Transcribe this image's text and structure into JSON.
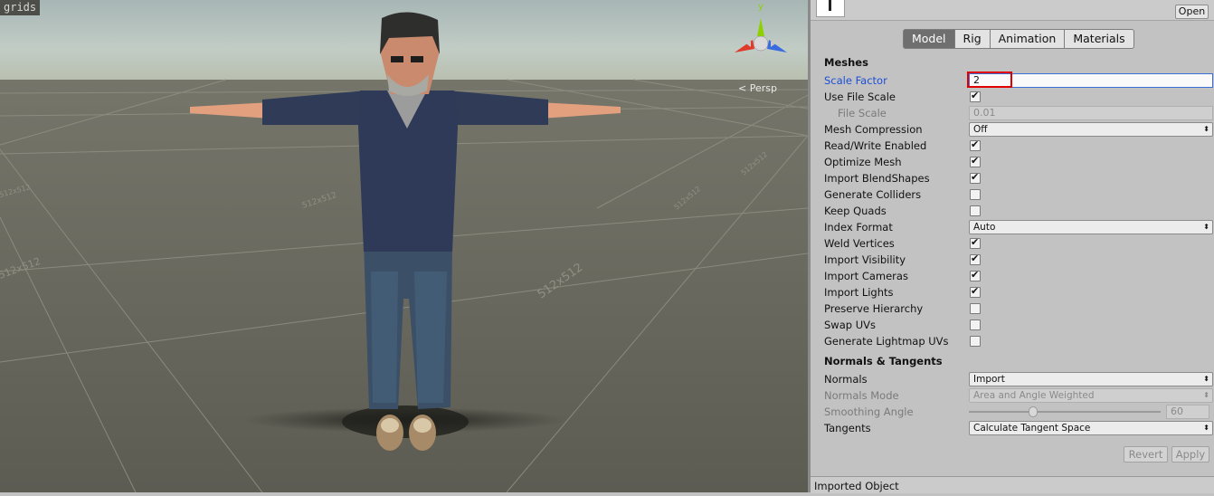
{
  "scene": {
    "grid_label": "grids",
    "projection": "Persp",
    "gizmo_axis": "y",
    "grid_texts": [
      "512x512",
      "512x512",
      "512x512",
      "512x512",
      "512x512",
      "512x512"
    ],
    "ground_color": "#64645a",
    "sky_color": "#b9c6c0"
  },
  "topbar": {
    "thumb_icon": "asset-preview-icon",
    "open_label": "Open"
  },
  "tabs": [
    {
      "label": "Model",
      "active": true
    },
    {
      "label": "Rig",
      "active": false
    },
    {
      "label": "Animation",
      "active": false
    },
    {
      "label": "Materials",
      "active": false
    }
  ],
  "meshes": {
    "header": "Meshes",
    "scale_factor": {
      "label": "Scale Factor",
      "value": "2"
    },
    "use_file_scale": {
      "label": "Use File Scale",
      "checked": true
    },
    "file_scale": {
      "label": "File Scale",
      "value": "0.01"
    },
    "mesh_compression": {
      "label": "Mesh Compression",
      "value": "Off"
    },
    "read_write_enabled": {
      "label": "Read/Write Enabled",
      "checked": true
    },
    "optimize_mesh": {
      "label": "Optimize Mesh",
      "checked": true
    },
    "import_blendshapes": {
      "label": "Import BlendShapes",
      "checked": true
    },
    "generate_colliders": {
      "label": "Generate Colliders",
      "checked": false
    },
    "keep_quads": {
      "label": "Keep Quads",
      "checked": false
    },
    "index_format": {
      "label": "Index Format",
      "value": "Auto"
    },
    "weld_vertices": {
      "label": "Weld Vertices",
      "checked": true
    },
    "import_visibility": {
      "label": "Import Visibility",
      "checked": true
    },
    "import_cameras": {
      "label": "Import Cameras",
      "checked": true
    },
    "import_lights": {
      "label": "Import Lights",
      "checked": true
    },
    "preserve_hierarchy": {
      "label": "Preserve Hierarchy",
      "checked": false
    },
    "swap_uvs": {
      "label": "Swap UVs",
      "checked": false
    },
    "generate_lightmap_uvs": {
      "label": "Generate Lightmap UVs",
      "checked": false
    }
  },
  "normals": {
    "header": "Normals & Tangents",
    "normals": {
      "label": "Normals",
      "value": "Import"
    },
    "normals_mode": {
      "label": "Normals Mode",
      "value": "Area and Angle Weighted"
    },
    "smoothing_angle": {
      "label": "Smoothing Angle",
      "value": "60",
      "fraction": 0.33
    },
    "tangents": {
      "label": "Tangents",
      "value": "Calculate Tangent Space"
    }
  },
  "actions": {
    "revert": "Revert",
    "apply": "Apply"
  },
  "footer": {
    "label": "Imported Object"
  },
  "check_glyph": "✔"
}
